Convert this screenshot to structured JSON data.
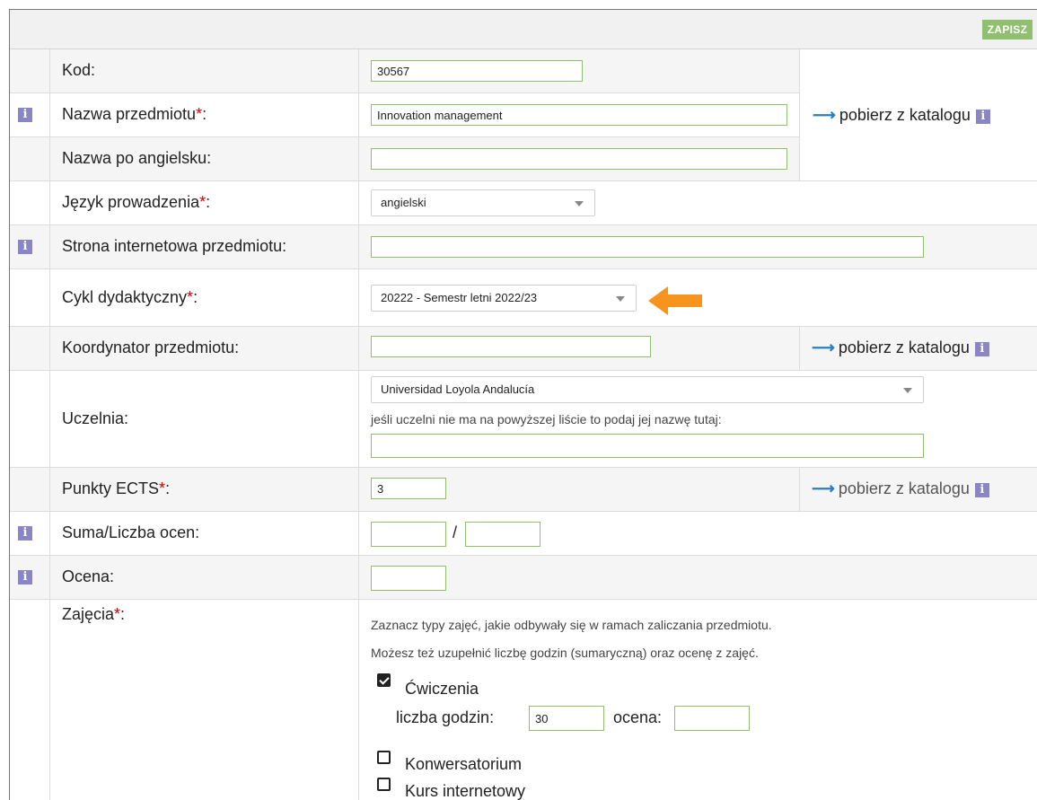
{
  "toolbar": {
    "save_label": "ZAPISZ"
  },
  "form": {
    "kod": {
      "label": "Kod:",
      "value": "30567"
    },
    "nazwa": {
      "label": "Nazwa przedmiotu",
      "req": "*",
      "colon": ":",
      "value": "Innovation management"
    },
    "nazwa_ang": {
      "label": "Nazwa po angielsku:",
      "value": ""
    },
    "jezyk": {
      "label": "Język prowadzenia",
      "req": "*",
      "colon": ":",
      "selected": "angielski"
    },
    "strona": {
      "label": "Strona internetowa przedmiotu:",
      "value": ""
    },
    "cykl": {
      "label": "Cykl dydaktyczny",
      "req": "*",
      "colon": ":",
      "selected": "20222 - Semestr letni 2022/23"
    },
    "koordynator": {
      "label": "Koordynator przedmiotu:",
      "value": ""
    },
    "uczelnia": {
      "label": "Uczelnia:",
      "selected": "Universidad Loyola Andalucía",
      "hint": "jeśli uczelni nie ma na powyższej liście to podaj jej nazwę tutaj:",
      "value": ""
    },
    "ects": {
      "label": "Punkty ECTS",
      "req": "*",
      "colon": ":",
      "value": "3"
    },
    "suma": {
      "label": "Suma/Liczba ocen:",
      "slash": "/",
      "value1": "",
      "value2": ""
    },
    "ocena": {
      "label": "Ocena:",
      "value": ""
    },
    "zajecia": {
      "label": "Zajęcia",
      "req": "*",
      "colon": ":",
      "hint1": "Zaznacz typy zajęć, jakie odbywały się w ramach zaliczania przedmiotu.",
      "hint2": "Możesz też uzupełnić liczbę godzin (sumaryczną) oraz ocenę z zajęć.",
      "items": [
        {
          "label": "Ćwiczenia",
          "checked": true,
          "hours_label": "liczba godzin:",
          "hours": "30",
          "grade_label": "ocena:",
          "grade": ""
        },
        {
          "label": "Konwersatorium",
          "checked": false
        },
        {
          "label": "Kurs internetowy",
          "checked": false
        }
      ]
    }
  },
  "catalog": {
    "link_label": "pobierz z katalogu",
    "arrow": "⟶",
    "info": "i"
  },
  "info_icon": "i",
  "colors": {
    "accent": "#8fbf6f",
    "info": "#8a86c6",
    "link_arrow": "#2b7ec1",
    "highlight_arrow": "#f7941d",
    "required": "#d00000"
  }
}
